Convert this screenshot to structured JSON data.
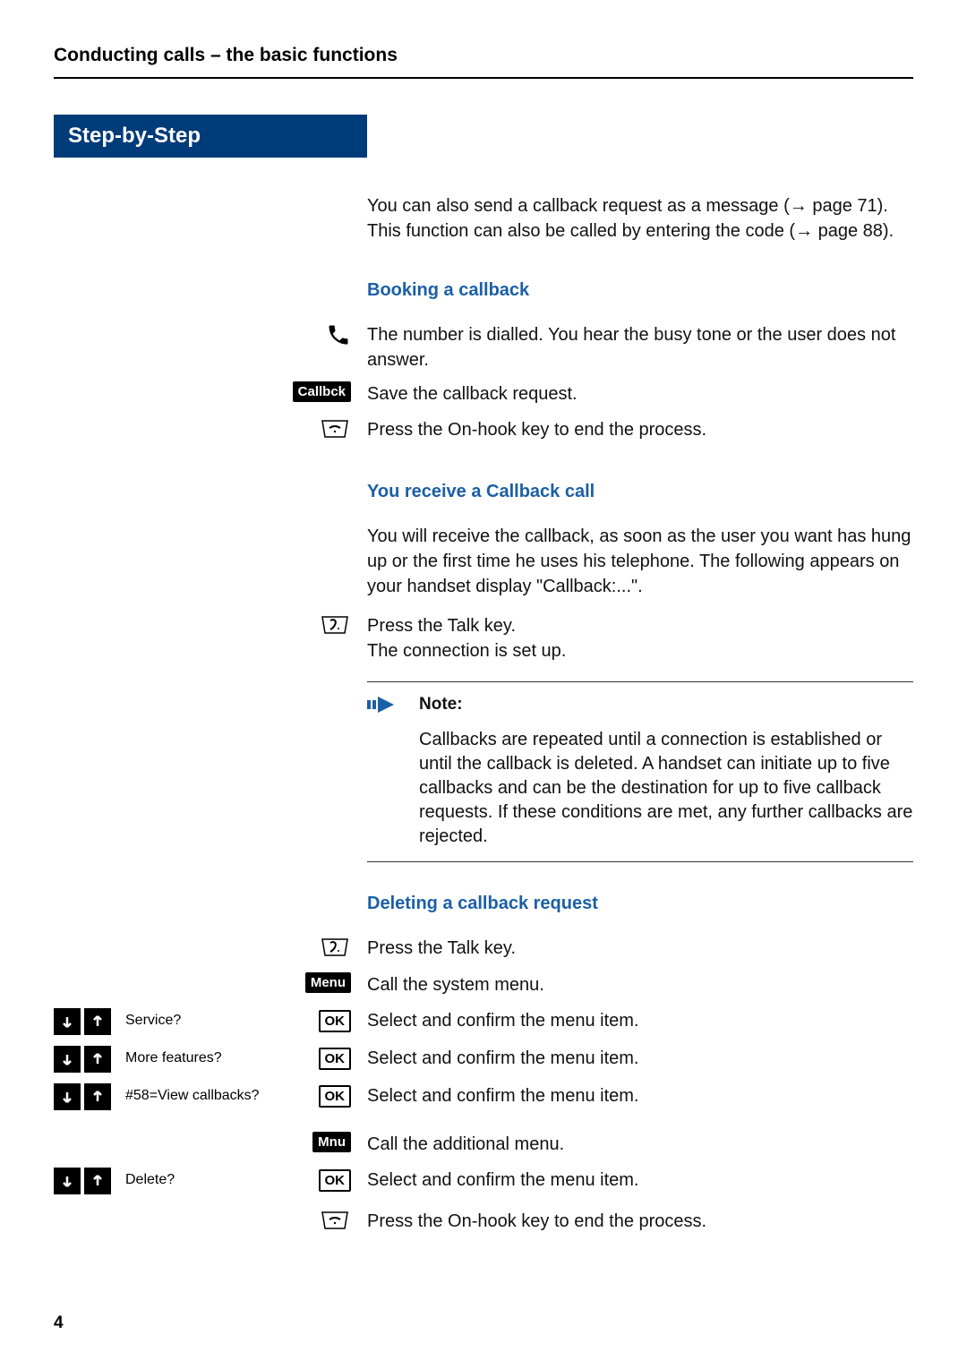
{
  "header": {
    "title": "Conducting calls – the basic functions"
  },
  "sidebar": {
    "banner": "Step-by-Step"
  },
  "intro": {
    "text1a": "You can also send a callback request as a message (",
    "text1b": " page 71). This function can also be called by entering the code (",
    "text1c": " page 88)."
  },
  "section_booking": {
    "heading": "Booking a callback",
    "step1": "The number is dialled. You hear the busy tone or the user does not answer.",
    "softkey_callbck": "Callbck",
    "step2": "Save the callback request.",
    "step3": "Press the On-hook key to end the process."
  },
  "section_receive": {
    "heading": "You receive a Callback call",
    "step1": "You will receive the callback, as soon as the user you want has hung up or the first time he uses his telephone. The following appears on your handset display \"Callback:...\".",
    "step2a": "Press the Talk key.",
    "step2b": "The connection is set up."
  },
  "note": {
    "label": "Note:",
    "text": "Callbacks are repeated until a connection is established or until the callback is deleted. A handset can initiate up to five callbacks and can be the destination for up to five callback requests. If these conditions are met, any further callbacks are rejected."
  },
  "section_delete": {
    "heading": "Deleting a callback request",
    "step_talk": "Press the Talk key.",
    "softkey_menu": "Menu",
    "step_menu": "Call the system menu.",
    "menu_items": {
      "service": "Service?",
      "more": "More features?",
      "view": "#58=View callbacks?",
      "delete": "Delete?"
    },
    "ok_label": "OK",
    "step_select": "Select and confirm the menu item.",
    "softkey_mnu": "Mnu",
    "step_mnu": "Call the additional menu.",
    "step_end": "Press the On-hook key to end the process."
  },
  "page_number": "4"
}
